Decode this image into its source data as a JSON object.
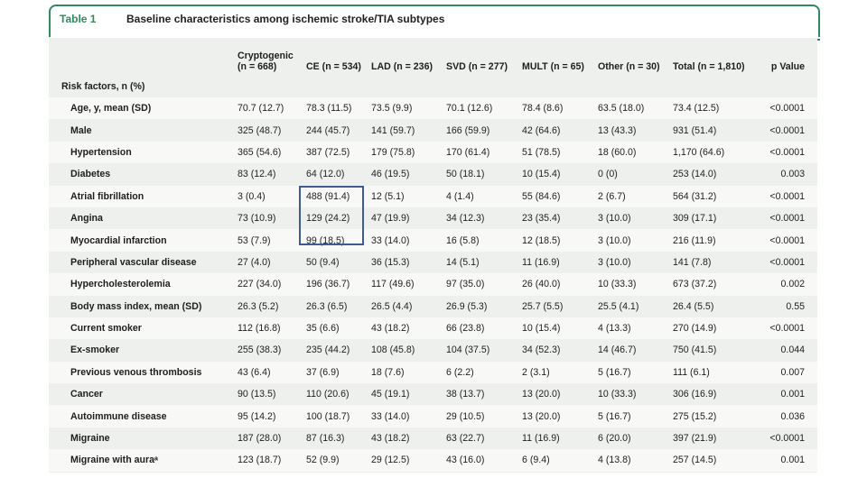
{
  "table_number": "Table 1",
  "table_title": "Baseline characteristics among ischemic stroke/TIA subtypes",
  "columns": [
    {
      "line1": "",
      "line2": ""
    },
    {
      "line1": "Cryptogenic",
      "line2": "(n = 668)"
    },
    {
      "line1": "",
      "line2": "CE (n = 534)"
    },
    {
      "line1": "",
      "line2": "LAD (n = 236)"
    },
    {
      "line1": "",
      "line2": "SVD (n = 277)"
    },
    {
      "line1": "",
      "line2": "MULT (n = 65)"
    },
    {
      "line1": "",
      "line2": "Other (n = 30)"
    },
    {
      "line1": "",
      "line2": "Total (n = 1,810)"
    },
    {
      "line1": "",
      "line2": "p Value"
    }
  ],
  "section_label": "Risk factors, n (%)",
  "rows": [
    [
      "Age, y, mean (SD)",
      "70.7 (12.7)",
      "78.3 (11.5)",
      "73.5 (9.9)",
      "70.1 (12.6)",
      "78.4 (8.6)",
      "63.5 (18.0)",
      "73.4 (12.5)",
      "<0.0001"
    ],
    [
      "Male",
      "325 (48.7)",
      "244 (45.7)",
      "141 (59.7)",
      "166 (59.9)",
      "42 (64.6)",
      "13 (43.3)",
      "931 (51.4)",
      "<0.0001"
    ],
    [
      "Hypertension",
      "365 (54.6)",
      "387 (72.5)",
      "179 (75.8)",
      "170 (61.4)",
      "51 (78.5)",
      "18 (60.0)",
      "1,170 (64.6)",
      "<0.0001"
    ],
    [
      "Diabetes",
      "83 (12.4)",
      "64 (12.0)",
      "46 (19.5)",
      "50 (18.1)",
      "10 (15.4)",
      "0 (0)",
      "253 (14.0)",
      "0.003"
    ],
    [
      "Atrial fibrillation",
      "3 (0.4)",
      "488 (91.4)",
      "12 (5.1)",
      "4 (1.4)",
      "55 (84.6)",
      "2 (6.7)",
      "564 (31.2)",
      "<0.0001"
    ],
    [
      "Angina",
      "73 (10.9)",
      "129 (24.2)",
      "47 (19.9)",
      "34 (12.3)",
      "23 (35.4)",
      "3 (10.0)",
      "309 (17.1)",
      "<0.0001"
    ],
    [
      "Myocardial infarction",
      "53 (7.9)",
      "99 (18.5)",
      "33 (14.0)",
      "16 (5.8)",
      "12 (18.5)",
      "3 (10.0)",
      "216 (11.9)",
      "<0.0001"
    ],
    [
      "Peripheral vascular disease",
      "27 (4.0)",
      "50 (9.4)",
      "36 (15.3)",
      "14 (5.1)",
      "11 (16.9)",
      "3 (10.0)",
      "141 (7.8)",
      "<0.0001"
    ],
    [
      "Hypercholesterolemia",
      "227 (34.0)",
      "196 (36.7)",
      "117 (49.6)",
      "97 (35.0)",
      "26 (40.0)",
      "10 (33.3)",
      "673 (37.2)",
      "0.002"
    ],
    [
      "Body mass index, mean (SD)",
      "26.3 (5.2)",
      "26.3 (6.5)",
      "26.5 (4.4)",
      "26.9 (5.3)",
      "25.7 (5.5)",
      "25.5 (4.1)",
      "26.4 (5.5)",
      "0.55"
    ],
    [
      "Current smoker",
      "112 (16.8)",
      "35 (6.6)",
      "43 (18.2)",
      "66 (23.8)",
      "10 (15.4)",
      "4 (13.3)",
      "270 (14.9)",
      "<0.0001"
    ],
    [
      "Ex-smoker",
      "255 (38.3)",
      "235 (44.2)",
      "108 (45.8)",
      "104 (37.5)",
      "34 (52.3)",
      "14 (46.7)",
      "750 (41.5)",
      "0.044"
    ],
    [
      "Previous venous thrombosis",
      "43 (6.4)",
      "37 (6.9)",
      "18 (7.6)",
      "6 (2.2)",
      "2 (3.1)",
      "5 (16.7)",
      "111 (6.1)",
      "0.007"
    ],
    [
      "Cancer",
      "90 (13.5)",
      "110 (20.6)",
      "45 (19.1)",
      "38 (13.7)",
      "13 (20.0)",
      "10 (33.3)",
      "306 (16.9)",
      "0.001"
    ],
    [
      "Autoimmune disease",
      "95 (14.2)",
      "100 (18.7)",
      "33 (14.0)",
      "29 (10.5)",
      "13 (20.0)",
      "5 (16.7)",
      "275 (15.2)",
      "0.036"
    ],
    [
      "Migraine",
      "187 (28.0)",
      "87 (16.3)",
      "43 (18.2)",
      "63 (22.7)",
      "11 (16.9)",
      "6 (20.0)",
      "397 (21.9)",
      "<0.0001"
    ],
    [
      "Migraine with auraᵃ",
      "123 (18.7)",
      "52 (9.9)",
      "29 (12.5)",
      "43 (16.0)",
      "6 (9.4)",
      "4 (13.8)",
      "257 (14.5)",
      "0.001"
    ]
  ],
  "colors": {
    "accent": "#2f8a5e",
    "highlight_box": "#3d5b94",
    "row_even": "#eef0ee",
    "row_odd": "#f8f8f7"
  }
}
